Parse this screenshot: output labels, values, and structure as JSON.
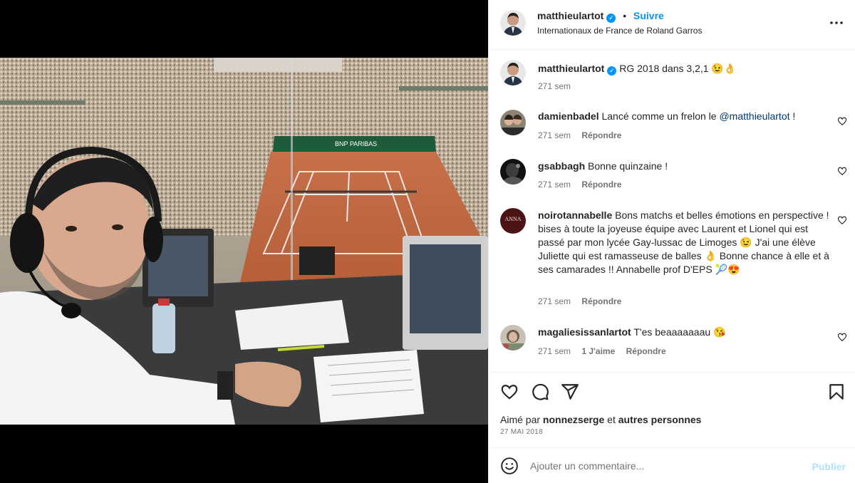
{
  "post_header": {
    "username": "matthieulartot",
    "follow_label": "Suivre",
    "separator": "•",
    "location": "Internationaux de France de Roland Garros",
    "more_label": "•••"
  },
  "caption": {
    "username": "matthieulartot",
    "text": "RG 2018 dans 3,2,1 😉👌",
    "time": "271 sem"
  },
  "comments": [
    {
      "username": "damienbadel",
      "text_before": "Lancé comme un frelon le ",
      "mention": "@matthieulartot",
      "text_after": " !",
      "time": "271 sem",
      "reply_label": "Répondre"
    },
    {
      "username": "gsabbagh",
      "text": "Bonne quinzaine !",
      "time": "271 sem",
      "reply_label": "Répondre"
    },
    {
      "username": "noirotannabelle",
      "text": "Bons matchs et belles émotions en perspective ! bises à toute la joyeuse équipe avec Laurent et Lionel qui est passé par mon lycée Gay-lussac de Limoges 😉 J'ai une élève Juliette qui est ramasseuse de balles 👌 Bonne chance à elle et à ses camarades !! Annabelle prof D'EPS 🎾😍",
      "time": "271 sem",
      "reply_label": "Répondre",
      "avatar_text": "ANNA"
    },
    {
      "username": "magaliesissanlartot",
      "text": "T'es beaaaaaaau 😘",
      "time": "271 sem",
      "likes_label": "1 J'aime",
      "reply_label": "Répondre"
    }
  ],
  "likes": {
    "prefix": "Aimé par",
    "user": "nonnezserge",
    "conj": "et",
    "others": "autres personnes",
    "date": "27 MAI 2018"
  },
  "comment_input": {
    "placeholder": "Ajouter un commentaire...",
    "publish_label": "Publier"
  },
  "colors": {
    "accent": "#0095f6",
    "muted": "#737373",
    "mention": "#00376b"
  },
  "icons": [
    "verified-icon",
    "more-icon",
    "heart-icon",
    "comment-icon",
    "share-icon",
    "save-icon",
    "emoji-icon"
  ]
}
